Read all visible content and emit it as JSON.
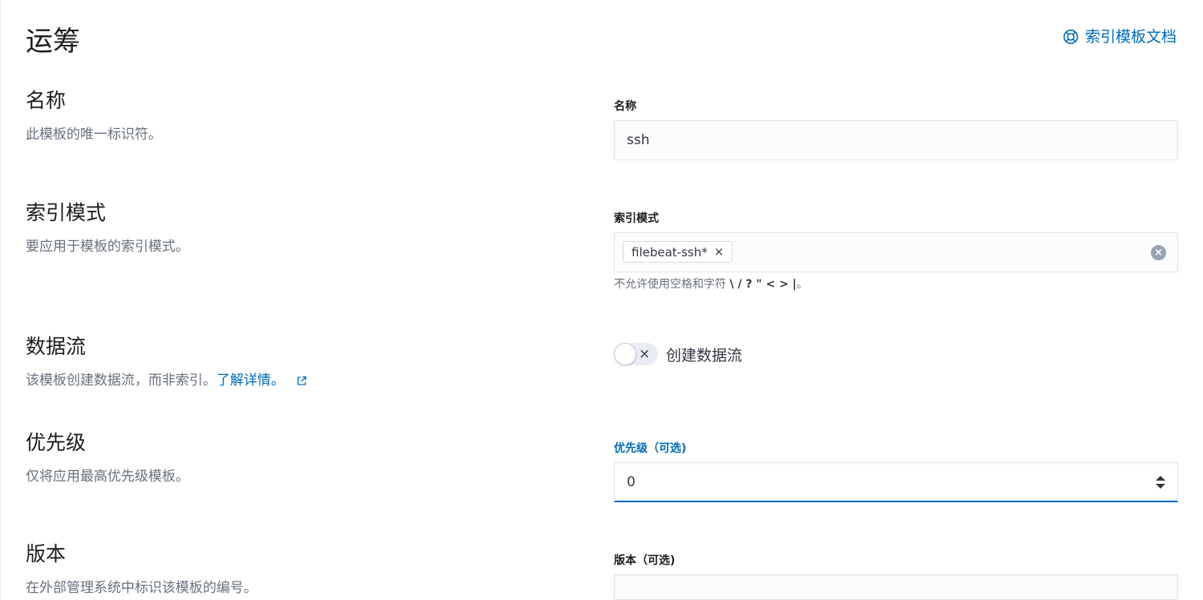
{
  "page": {
    "title": "运筹",
    "doc_link": "索引模板文档"
  },
  "sections": {
    "name": {
      "title": "名称",
      "description": "此模板的唯一标识符。",
      "label": "名称",
      "value": "ssh"
    },
    "index_patterns": {
      "title": "索引模式",
      "description": "要应用于模板的索引模式。",
      "label": "索引模式",
      "pill": "filebeat-ssh*",
      "pill_close": "×",
      "help_prefix": "不允许使用空格和字符",
      "help_chars": "\\ / ? \" < > |",
      "help_suffix": "。"
    },
    "data_stream": {
      "title": "数据流",
      "description": "该模板创建数据流，而非索引。",
      "learn_more": "了解详情。",
      "switch_label": "创建数据流",
      "switch_icon": "×",
      "enabled": false
    },
    "priority": {
      "title": "优先级",
      "description": "仅将应用最高优先级模板。",
      "label": "优先级（可选)",
      "value": "0"
    },
    "version": {
      "title": "版本",
      "description": "在外部管理系统中标识该模板的编号。",
      "label": "版本（可选)",
      "value": ""
    }
  },
  "colors": {
    "accent": "#006bb8",
    "text": "#343741",
    "subdued": "#69707d"
  }
}
